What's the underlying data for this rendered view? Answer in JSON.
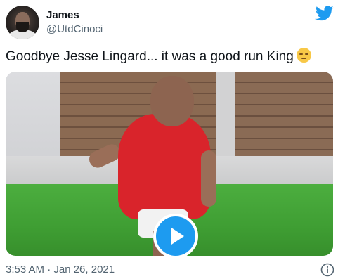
{
  "author": {
    "name": "James",
    "handle": "@UtdCinoci"
  },
  "tweet": {
    "text": "Goodbye Jesse Lingard... it was a good run King",
    "emoji": "pensive-face-emoji",
    "timestamp": "3:53 AM · Jan 26, 2021"
  },
  "icons": {
    "brand": "twitter-bird-icon",
    "play": "play-icon",
    "info": "info-icon"
  },
  "colors": {
    "accent": "#1d9bf0",
    "text": "#0f1419",
    "secondary": "#536471"
  }
}
